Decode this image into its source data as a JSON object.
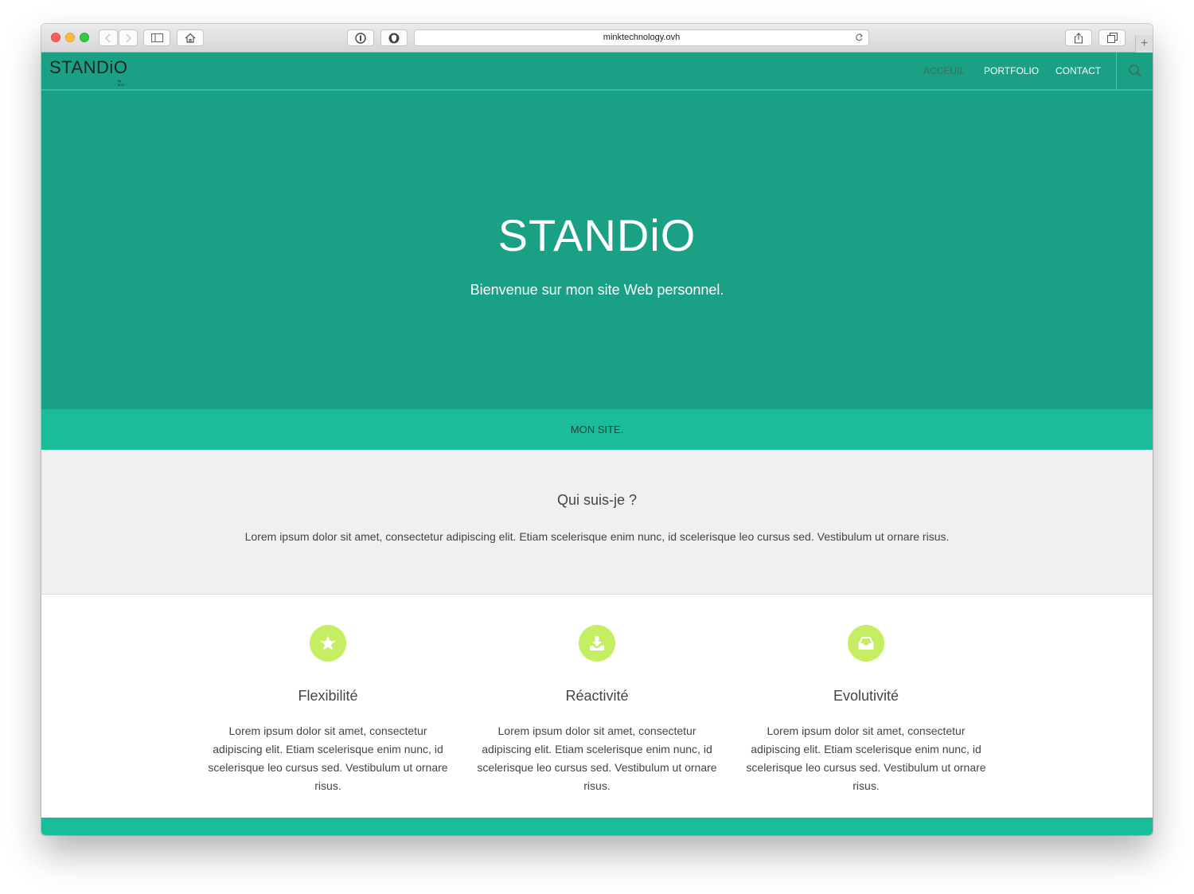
{
  "browser": {
    "url": "minktechnology.ovh",
    "new_tab_label": "+"
  },
  "site": {
    "logo_text": "STANDiO",
    "logo_sub": "by M.M",
    "nav": {
      "items": [
        {
          "label": "ACCEUIL"
        },
        {
          "label": "PORTFOLIO"
        },
        {
          "label": "CONTACT"
        }
      ]
    },
    "hero": {
      "title": "STANDiO",
      "subtitle": "Bienvenue sur mon site Web personnel."
    },
    "band_text": "MON SITE.",
    "about": {
      "title": "Qui suis-je ?",
      "text": "Lorem ipsum dolor sit amet, consectetur adipiscing elit. Etiam scelerisque enim nunc, id scelerisque leo cursus sed. Vestibulum ut ornare risus."
    },
    "features": [
      {
        "icon": "star-icon",
        "title": "Flexibilité",
        "text": "Lorem ipsum dolor sit amet, consectetur adipiscing elit. Etiam scelerisque enim nunc, id scelerisque leo cursus sed. Vestibulum ut ornare risus."
      },
      {
        "icon": "download-icon",
        "title": "Réactivité",
        "text": "Lorem ipsum dolor sit amet, consectetur adipiscing elit. Etiam scelerisque enim nunc, id scelerisque leo cursus sed. Vestibulum ut ornare risus."
      },
      {
        "icon": "inbox-icon",
        "title": "Evolutivité",
        "text": "Lorem ipsum dolor sit amet, consectetur adipiscing elit. Etiam scelerisque enim nunc, id scelerisque leo cursus sed. Vestibulum ut ornare risus."
      }
    ]
  },
  "colors": {
    "primary": "#1aa185",
    "accent": "#1bbc99",
    "icon_circle": "#c6ee62",
    "nav_active": "#3d6e5c"
  }
}
